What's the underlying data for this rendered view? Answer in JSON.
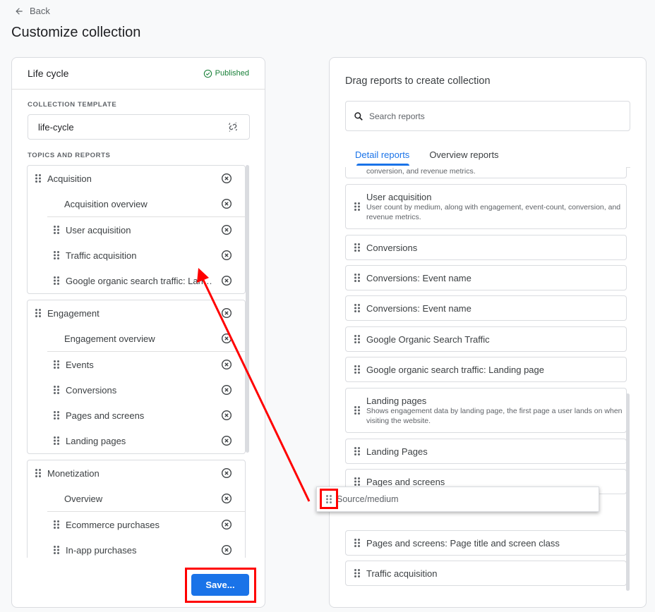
{
  "header": {
    "back_label": "Back",
    "title": "Customize collection"
  },
  "left_panel": {
    "title": "Life cycle",
    "status": "Published",
    "status_color": "#188038",
    "template_label": "COLLECTION TEMPLATE",
    "template_value": "life-cycle",
    "topics_label": "TOPICS AND REPORTS",
    "topics": [
      {
        "name": "Acquisition",
        "overview": "Acquisition overview",
        "reports": [
          "User acquisition",
          "Traffic acquisition",
          "Google organic search traffic: Landing page"
        ]
      },
      {
        "name": "Engagement",
        "overview": "Engagement overview",
        "reports": [
          "Events",
          "Conversions",
          "Pages and screens",
          "Landing pages"
        ]
      },
      {
        "name": "Monetization",
        "overview": "Overview",
        "reports": [
          "Ecommerce purchases",
          "In-app purchases"
        ]
      }
    ],
    "save_label": "Save..."
  },
  "right_panel": {
    "title": "Drag reports to create collection",
    "search_placeholder": "Search reports",
    "tabs": [
      {
        "label": "Detail reports",
        "active": true
      },
      {
        "label": "Overview reports",
        "active": false
      }
    ],
    "reports": [
      {
        "title": "",
        "description": "conversion, and revenue metrics."
      },
      {
        "title": "User acquisition",
        "description": "User count by medium, along with engagement, event-count, conversion, and revenue metrics."
      },
      {
        "title": "Conversions",
        "description": ""
      },
      {
        "title": "Conversions: Event name",
        "description": ""
      },
      {
        "title": "Conversions: Event name",
        "description": ""
      },
      {
        "title": "Google Organic Search Traffic",
        "description": ""
      },
      {
        "title": "Google organic search traffic: Landing page",
        "description": ""
      },
      {
        "title": "Landing pages",
        "description": "Shows engagement data by landing page, the first page a user lands on when visiting the website."
      },
      {
        "title": "Landing Pages",
        "description": ""
      },
      {
        "title": "Pages and screens",
        "description": ""
      },
      {
        "title": "Pages and screens: Page title and screen class",
        "description": ""
      },
      {
        "title": "Traffic acquisition",
        "description": ""
      }
    ],
    "dragging_item": "Source/medium"
  },
  "annotations": {
    "highlight_color": "#ff0000",
    "accent_color": "#1a73e8"
  }
}
